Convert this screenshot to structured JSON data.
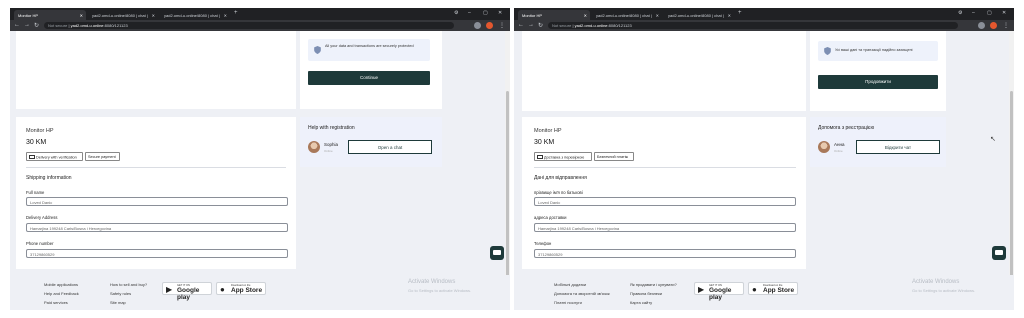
{
  "left": {
    "browser": {
      "tabs": [
        "Monitor HP",
        "yad2.omd-u.online/8080 | chat | ",
        "yad2.omd-u.online/8080 | chat | "
      ],
      "address": {
        "not_secure": "Not secure",
        "host": "yad2.omd-u.online",
        "path": ":8080/121123"
      }
    },
    "secure_note": "All your data and transactions are securely protected",
    "continue_label": "Continue",
    "product": {
      "title": "Monitor HP",
      "price": "30 KM"
    },
    "chips": [
      "Delivery with verification",
      "Secure payment"
    ],
    "shipping": {
      "title": "Shipping information",
      "fields": [
        {
          "label": "Full name",
          "value": "Loved Danic"
        },
        {
          "label": "Delivery Address",
          "value": "Hamarjina 199248 Сarls/Bosna i Hercegovina"
        },
        {
          "label": "Phone number",
          "value": "37129860529"
        }
      ]
    },
    "help": {
      "title": "Help with registration",
      "agent_name": "Sophia",
      "agent_sub": "Online",
      "open_chat": "Open a chat"
    },
    "footer": {
      "col1": [
        "Mobile applications",
        "Help and Feedback",
        "Paid services"
      ],
      "col2": [
        "How to sell and buy?",
        "Safety rules",
        "Site map"
      ]
    }
  },
  "right": {
    "browser": {
      "tabs": [
        "Monitor HP",
        "yad2.omd-u.online/8080 | chat | ",
        "yad2.omd-u.online/8080 | chat | "
      ],
      "address": {
        "not_secure": "Not secure",
        "host": "yad2.omd-u.online",
        "path": ":8080/121123"
      }
    },
    "secure_note": "Усі ваші дані та транзакції надійно захищені",
    "continue_label": "Продовжити",
    "product": {
      "title": "Monitor HP",
      "price": "30 KM"
    },
    "chips": [
      "Доставка з перевіркою",
      "Безпечний платіж"
    ],
    "shipping": {
      "title": "Дані для відправлення",
      "fields": [
        {
          "label": "прізвище ім'я по батькові",
          "value": "Loved Danic"
        },
        {
          "label": "адреса доставки",
          "value": "Hamarjina 199248 Сarls/Bosna i Hercegovina"
        },
        {
          "label": "Телефон",
          "value": "37129860529"
        }
      ]
    },
    "help": {
      "title": "Допомога з реєстрацією",
      "agent_name": "Анна",
      "agent_sub": "Online",
      "open_chat": "Відкрити чат"
    },
    "footer": {
      "col1": [
        "Мобільні додатки",
        "Допомога та зворотній зв'язок",
        "Платні послуги"
      ],
      "col2": [
        "Як продавати і купувати?",
        "Правила безпеки",
        "Карта сайту"
      ]
    }
  },
  "shared": {
    "google_play_small": "GET IT ON",
    "google_play_big": "Google play",
    "app_store_small": "Download on the",
    "app_store_big": "App Store",
    "activate_title": "Activate Windows",
    "activate_sub": "Go to Settings to activate Windows."
  },
  "colors": {
    "accent": "#1e3a3a",
    "help_bg": "#eef1fb",
    "page_bg": "#eef0f5"
  }
}
